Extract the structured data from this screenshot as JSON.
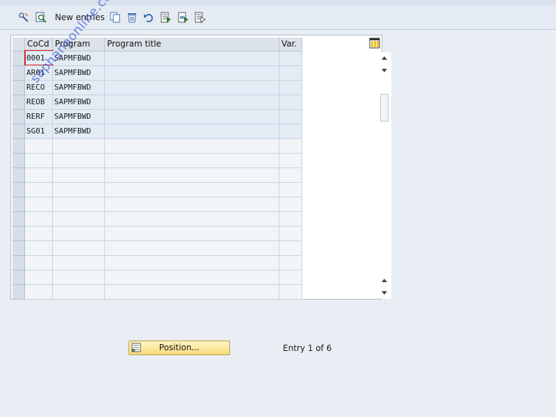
{
  "toolbar": {
    "new_entries_label": "New entries",
    "icons": [
      "display-change-icon",
      "details-icon",
      "copy-icon",
      "delete-icon",
      "undo-icon",
      "select-all-icon",
      "select-block-icon",
      "deselect-all-icon"
    ]
  },
  "table": {
    "columns": [
      "CoCd",
      "Program",
      "Program title",
      "Var."
    ],
    "rows": [
      {
        "cocd": "0001",
        "program": "SAPMFBWD",
        "title": "",
        "var": ""
      },
      {
        "cocd": "AR01",
        "program": "SAPMFBWD",
        "title": "",
        "var": ""
      },
      {
        "cocd": "RECO",
        "program": "SAPMFBWD",
        "title": "",
        "var": ""
      },
      {
        "cocd": "REOB",
        "program": "SAPMFBWD",
        "title": "",
        "var": ""
      },
      {
        "cocd": "RERF",
        "program": "SAPMFBWD",
        "title": "",
        "var": ""
      },
      {
        "cocd": "SG01",
        "program": "SAPMFBWD",
        "title": "",
        "var": ""
      }
    ],
    "empty_rows": 11
  },
  "footer": {
    "position_button_label": "Position...",
    "entry_text": "Entry 1 of 6"
  },
  "watermark": "saphanaonline.com",
  "colors": {
    "accent_button": "#f7dc7c",
    "filled_row": "#e3ecf5"
  }
}
